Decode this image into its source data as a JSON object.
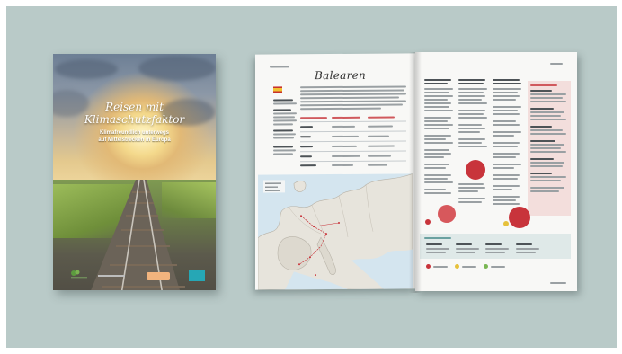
{
  "cover": {
    "title_line1": "Reisen mit",
    "title_line2": "Klimaschutzfaktor",
    "subtitle_line1": "Klimafreundlich unterwegs",
    "subtitle_line2": "auf Mittelstrecken in Europa"
  },
  "brochure": {
    "left_page_title": "Balearen"
  },
  "colors": {
    "backdrop": "#b9cac8",
    "accent_red": "#c8343b",
    "accent_pink": "#f3dedc",
    "map_sea": "#d4e5ef"
  }
}
